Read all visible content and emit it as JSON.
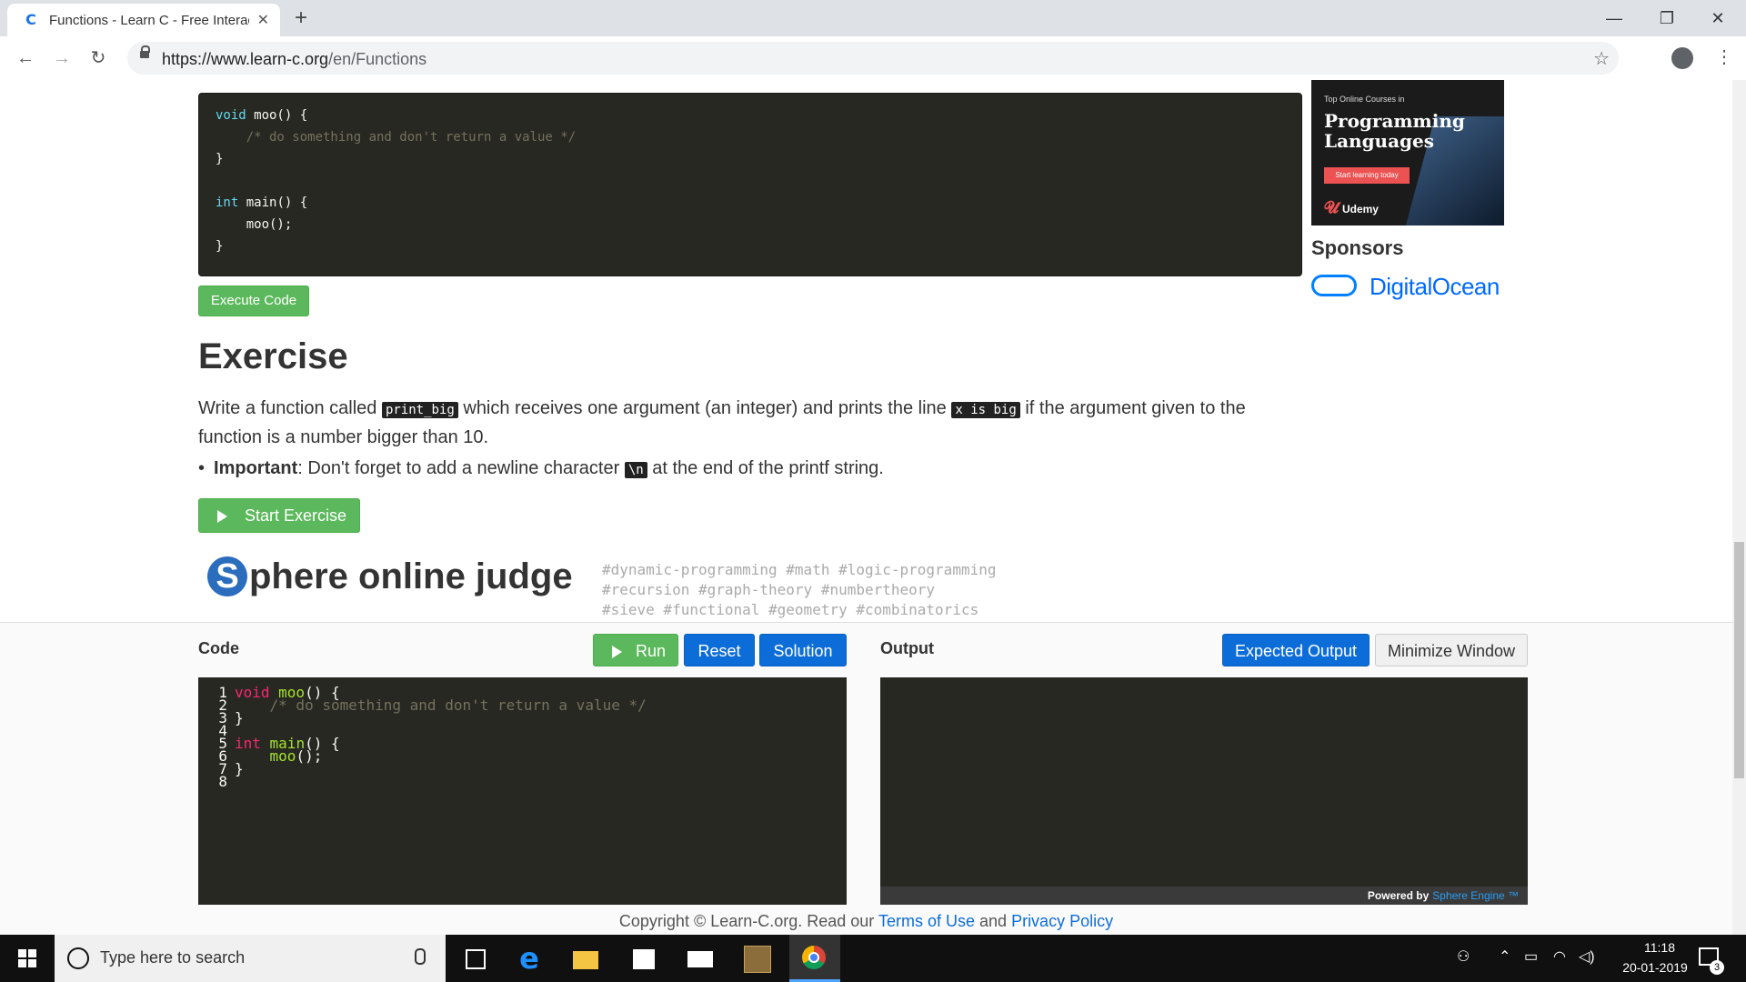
{
  "browser": {
    "tab_title": "Functions - Learn C - Free Interac",
    "url_host": "https://www.learn-c.org",
    "url_path": "/en/Functions"
  },
  "code_sample": {
    "lines": [
      [
        "void",
        " moo() {"
      ],
      [
        "",
        "    /* do something and don't return a value */"
      ],
      [
        "",
        "}"
      ],
      [
        "",
        ""
      ],
      [
        "int",
        " main() {"
      ],
      [
        "",
        "    moo();"
      ],
      [
        "",
        "}"
      ]
    ]
  },
  "execute_label": "Execute Code",
  "exercise": {
    "title": "Exercise",
    "desc_part1": "Write a function called ",
    "code1": "print_big",
    "desc_part2": " which receives one argument (an integer) and prints the line ",
    "code2": "x is big",
    "desc_part3": " if the argument given to the function is a number bigger than 10.",
    "important_label": "Important",
    "important_text1": ": Don't forget to add a newline character ",
    "important_code": "\\n",
    "important_text2": " at the end of the printf string.",
    "start_label": "Start Exercise"
  },
  "spoj": {
    "s": "S",
    "text": "phere online judge",
    "tags": [
      "#dynamic-programming #math #logic-programming",
      "#recursion #graph-theory #numbertheory",
      "#sieve #functional #geometry #combinatorics"
    ]
  },
  "sidebar": {
    "ad_small": "Top Online Courses in",
    "ad_title": "Programming Languages",
    "ad_cta": "Start learning today",
    "ad_brand": "Udemy",
    "sponsors_title": "Sponsors",
    "sponsor_name": "DigitalOcean"
  },
  "panel": {
    "code_label": "Code",
    "output_label": "Output",
    "run": "Run",
    "reset": "Reset",
    "solution": "Solution",
    "expected": "Expected Output",
    "minimize": "Minimize Window",
    "powered_by": "Powered by",
    "sphere_engine": "Sphere Engine ™",
    "editor_lines": [
      {
        "n": "1",
        "kw": "void",
        "fn": " moo",
        "rest": "() {",
        "cm": ""
      },
      {
        "n": "2",
        "kw": "",
        "fn": "",
        "rest": "    ",
        "cm": "/* do something and don't return a value */"
      },
      {
        "n": "3",
        "kw": "",
        "fn": "",
        "rest": "}",
        "cm": ""
      },
      {
        "n": "4",
        "kw": "",
        "fn": "",
        "rest": "",
        "cm": ""
      },
      {
        "n": "5",
        "kw": "int",
        "fn": " main",
        "rest": "() {",
        "cm": ""
      },
      {
        "n": "6",
        "kw": "",
        "fn": "    moo",
        "rest": "();",
        "cm": ""
      },
      {
        "n": "7",
        "kw": "",
        "fn": "",
        "rest": "}",
        "cm": ""
      },
      {
        "n": "8",
        "kw": "",
        "fn": "",
        "rest": "",
        "cm": ""
      }
    ]
  },
  "footer": {
    "copyright": "Copyright © Learn-C.org. Read our ",
    "terms": "Terms of Use",
    "and": " and ",
    "privacy": "Privacy Policy"
  },
  "taskbar": {
    "search_placeholder": "Type here to search",
    "time": "11:18",
    "date": "20-01-2019",
    "notifications": "3"
  }
}
